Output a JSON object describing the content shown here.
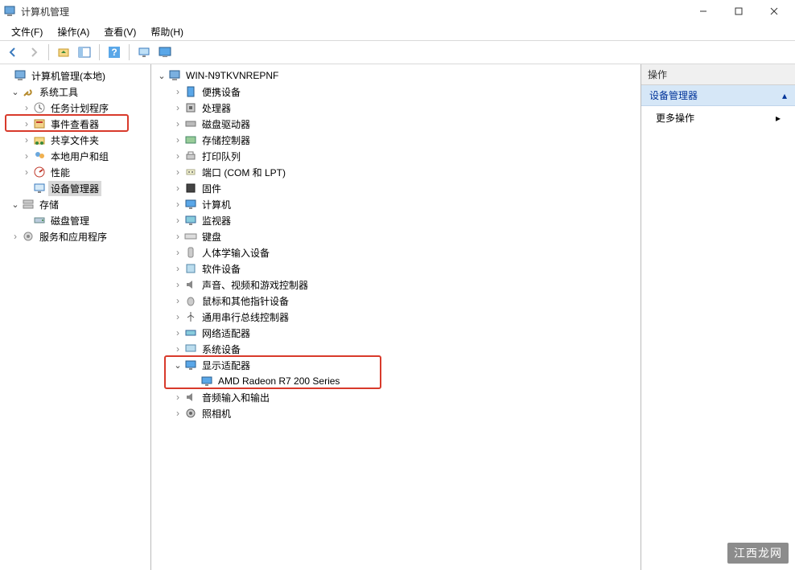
{
  "window": {
    "title": "计算机管理"
  },
  "menu": {
    "file": "文件(F)",
    "action": "操作(A)",
    "view": "查看(V)",
    "help": "帮助(H)"
  },
  "left_tree": {
    "root": "计算机管理(本地)",
    "sys_tools": "系统工具",
    "task_sched": "任务计划程序",
    "event_viewer": "事件查看器",
    "shared_folders": "共享文件夹",
    "local_users": "本地用户和组",
    "performance": "性能",
    "device_manager": "设备管理器",
    "storage": "存储",
    "disk_mgmt": "磁盘管理",
    "services_apps": "服务和应用程序"
  },
  "center_tree": {
    "root": "WIN-N9TKVNREPNF",
    "portable": "便携设备",
    "processors": "处理器",
    "disk_drives": "磁盘驱动器",
    "storage_ctrl": "存储控制器",
    "print_queues": "打印队列",
    "ports": "端口 (COM 和 LPT)",
    "firmware": "固件",
    "computers": "计算机",
    "monitors": "监视器",
    "keyboards": "键盘",
    "hid": "人体学输入设备",
    "soft_devices": "软件设备",
    "sound": "声音、视频和游戏控制器",
    "mice": "鼠标和其他指针设备",
    "usb": "通用串行总线控制器",
    "netadapters": "网络适配器",
    "sysdevices": "系统设备",
    "display": "显示适配器",
    "display_child": "AMD Radeon R7 200 Series",
    "audio_io": "音频输入和输出",
    "cameras": "照相机"
  },
  "actions": {
    "header": "操作",
    "section": "设备管理器",
    "more": "更多操作"
  },
  "watermark": "江西龙网"
}
